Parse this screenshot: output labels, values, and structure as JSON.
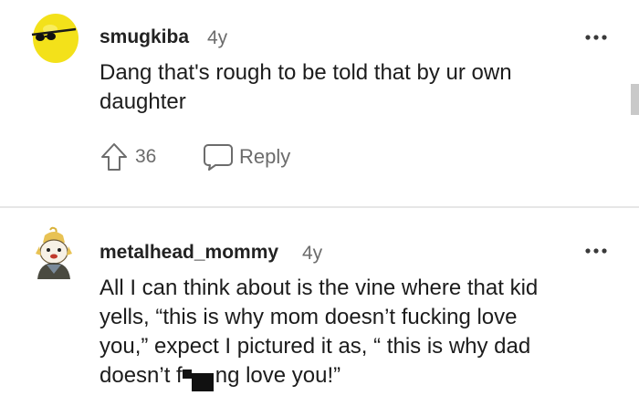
{
  "comments": [
    {
      "username": "smugkiba",
      "age": "4y",
      "text": "Dang that's rough to be told that by ur own daughter",
      "upvotes": "36",
      "reply_label": "Reply",
      "avatar_icon": "yellow-ball-with-sunglasses-avatar"
    },
    {
      "username": "metalhead_mommy",
      "age": "4y",
      "text_line_1": "All I can think about is the vine where that kid",
      "text_line_2": "yells, “this is why mom doesn’t fucking love",
      "text_line_3": "you,” expect I pictured it as, “ this is why dad",
      "text_line_4_start": "doesn’t f",
      "text_line_4_end": "ng love you!”",
      "avatar_icon": "cartoon-character-avatar"
    }
  ],
  "icons": {
    "more": "more-horizontal-icon",
    "upvote": "upvote-arrow-icon",
    "reply": "speech-bubble-icon"
  },
  "colors": {
    "avatar_yellow": "#f3e11a",
    "text": "#1c1c1c",
    "meta": "#6c6c6c"
  }
}
